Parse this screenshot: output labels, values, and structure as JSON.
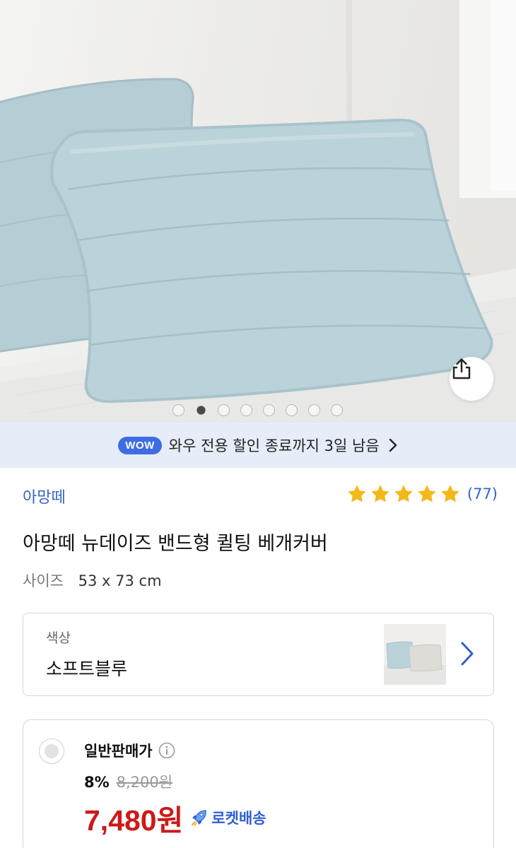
{
  "hero": {
    "image_alt": "아망떼 뉴데이즈 밴드형 퀼팅 베개커버",
    "slide_count": 8,
    "active_slide": 2
  },
  "wow_banner": {
    "badge": "WOW",
    "text": "와우 전용 할인 종료까지 3일 남음"
  },
  "product": {
    "brand": "아망떼",
    "rating_stars": 5,
    "rating_count": "(77)",
    "title": "아망떼 뉴데이즈 밴드형 퀼팅 베개커버",
    "size_label": "사이즈",
    "size_value": "53 x 73 cm"
  },
  "option": {
    "label": "색상",
    "value": "소프트블루"
  },
  "price": {
    "type_label": "일반판매가",
    "discount": "8%",
    "original": "8,200원",
    "sale": "7,480원",
    "shipping": "로켓배송"
  },
  "colors": {
    "accent_blue": "#3463c8",
    "wow_badge": "#3d6ce4",
    "wow_banner_bg": "#e6ecf8",
    "star": "#f5b719",
    "sale_red": "#cc1a1a",
    "pillow_blue": "#b9d2d9"
  },
  "icons": {
    "share": "share-icon",
    "chevron": "chevron-right-icon",
    "star": "star-icon",
    "info": "info-icon",
    "rocket": "rocket-icon"
  }
}
